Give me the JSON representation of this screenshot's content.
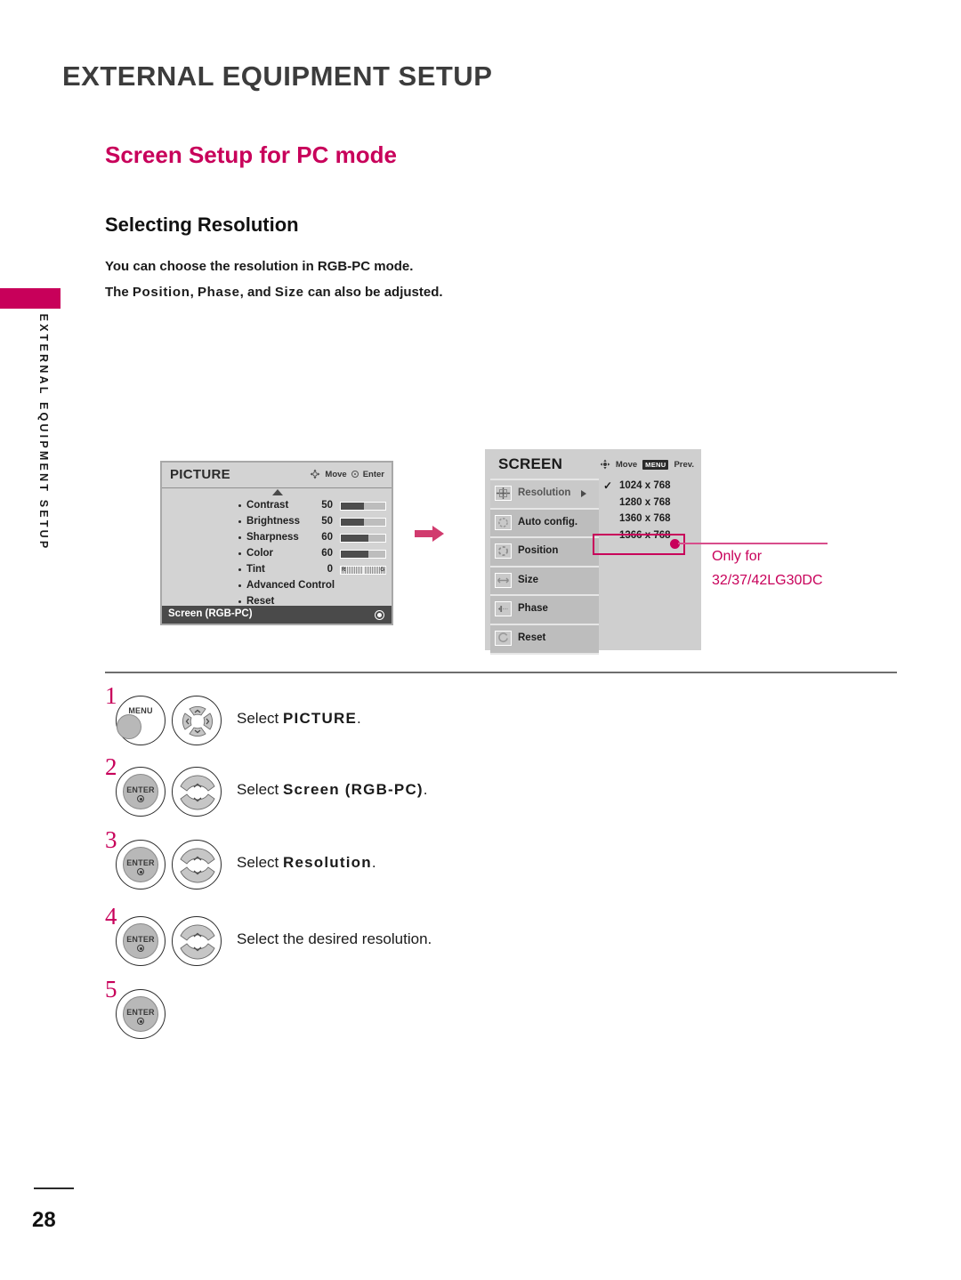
{
  "page": {
    "chapter_title": "EXTERNAL EQUIPMENT SETUP",
    "section_title": "Screen Setup for PC mode",
    "sub_title": "Selecting Resolution",
    "body_line_1": "You can choose the resolution in RGB-PC mode.",
    "body_line_2_pre": "The ",
    "body_line_2_a": "Position",
    "body_line_2_sep1": ", ",
    "body_line_2_b": "Phase",
    "body_line_2_sep2": ", and ",
    "body_line_2_c": "Size",
    "body_line_2_post": " can also be adjusted.",
    "side_tab_label": "EXTERNAL EQUIPMENT SETUP",
    "page_number": "28",
    "accent_color": "#c8005a"
  },
  "picture_menu": {
    "title": "PICTURE",
    "hint_move": "Move",
    "hint_enter": "Enter",
    "rows": [
      {
        "label": "Contrast",
        "value": "50",
        "fill": 52
      },
      {
        "label": "Brightness",
        "value": "50",
        "fill": 52
      },
      {
        "label": "Sharpness",
        "value": "60",
        "fill": 62
      },
      {
        "label": "Color",
        "value": "60",
        "fill": 62
      },
      {
        "label": "Tint",
        "value": "0",
        "tint": true,
        "left_mark": "R",
        "right_mark": "G"
      },
      {
        "label": "Advanced Control",
        "value": "",
        "nobar": true
      },
      {
        "label": "Reset",
        "value": "",
        "nobar": true
      }
    ],
    "footer_label": "Screen (RGB-PC)"
  },
  "screen_menu": {
    "title": "SCREEN",
    "hint_move": "Move",
    "hint_menu_key": "MENU",
    "hint_prev": "Prev.",
    "items": [
      {
        "label": "Resolution",
        "icon": "crosshair-icon",
        "selected": true
      },
      {
        "label": "Auto config.",
        "icon": "auto-config-icon",
        "selected": false
      },
      {
        "label": "Position",
        "icon": "position-icon",
        "selected": false
      },
      {
        "label": "Size",
        "icon": "size-icon",
        "selected": false
      },
      {
        "label": "Phase",
        "icon": "phase-icon",
        "selected": false
      },
      {
        "label": "Reset",
        "icon": "reset-icon",
        "selected": false
      }
    ],
    "resolutions": [
      {
        "label": "1024 x 768",
        "checked": true
      },
      {
        "label": "1280 x 768",
        "checked": false
      },
      {
        "label": "1360 x 768",
        "checked": false
      },
      {
        "label": "1366 x 768",
        "checked": false,
        "highlighted": true
      }
    ],
    "check_glyph": "✓"
  },
  "callout": {
    "line1": "Only for",
    "line2": "32/37/42LG30DC"
  },
  "steps": [
    {
      "number": "1",
      "button_label": "MENU",
      "button_type": "menu",
      "nav_type": "dpad",
      "text_pre": "Select ",
      "text_bold": "PICTURE",
      "text_post": "."
    },
    {
      "number": "2",
      "button_label": "ENTER",
      "button_type": "enter",
      "nav_type": "updown",
      "text_pre": "Select ",
      "text_bold": "Screen (RGB-PC)",
      "text_post": "."
    },
    {
      "number": "3",
      "button_label": "ENTER",
      "button_type": "enter",
      "nav_type": "updown",
      "text_pre": "Select ",
      "text_bold": "Resolution",
      "text_post": "."
    },
    {
      "number": "4",
      "button_label": "ENTER",
      "button_type": "enter",
      "nav_type": "updown",
      "text_pre": "Select the desired resolution.",
      "text_bold": "",
      "text_post": ""
    },
    {
      "number": "5",
      "button_label": "ENTER",
      "button_type": "enter",
      "nav_type": "none",
      "text_pre": "",
      "text_bold": "",
      "text_post": ""
    }
  ]
}
